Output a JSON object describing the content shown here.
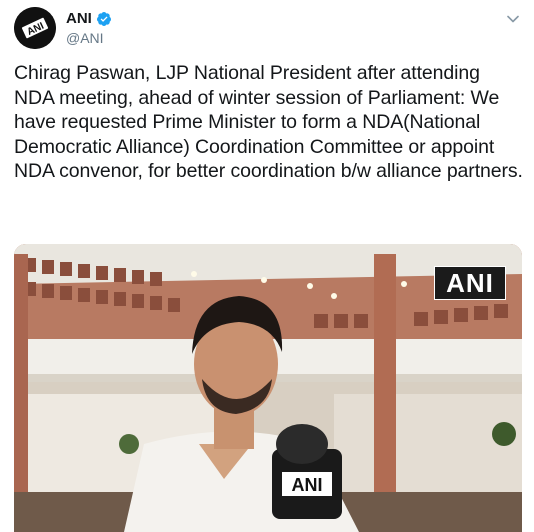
{
  "author": {
    "avatar_text": "ANI",
    "name": "ANI",
    "handle": "@ANI",
    "verified": true,
    "avatar_icon": "ani-logo",
    "verified_icon": "verified-badge-icon",
    "menu_icon": "chevron-down-icon"
  },
  "tweet": {
    "text": "Chirag Paswan, LJP National President after attending NDA meeting, ahead of winter session of Parliament: We have requested Prime Minister to form a NDA(National Democratic Alliance) Coordination Committee or appoint NDA convenor, for better coordination b/w alliance partners."
  },
  "media": {
    "type": "video-still",
    "watermark": "ANI",
    "mic_label": "ANI"
  },
  "colors": {
    "text": "#14171a",
    "secondary": "#657786",
    "verified": "#1da1f2"
  }
}
